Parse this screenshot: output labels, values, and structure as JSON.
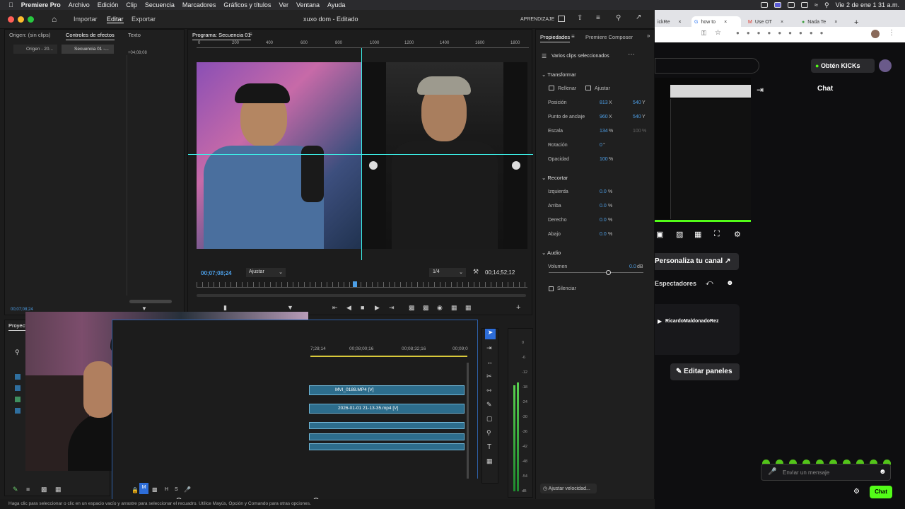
{
  "menubar": {
    "items": [
      "Premiere Pro",
      "Archivo",
      "Edición",
      "Clip",
      "Secuencia",
      "Marcadores",
      "Gráficos y títulos",
      "Ver",
      "Ventana",
      "Ayuda"
    ],
    "clock": "Vie 2 de ene  1 31 a.m."
  },
  "premiere": {
    "nav": {
      "import": "Importar",
      "edit": "Editar",
      "export": "Exportar"
    },
    "doc_title": "xuxo dom - Editado",
    "learning": "APRENDIZAJE",
    "source_panel": {
      "tabs": [
        "Origen: (sin clips)",
        "Controles de efectos",
        "Texto"
      ],
      "sub_tabs": [
        "Origen - 20...",
        "Secuencia 01 -..."
      ],
      "timecode_mini": "+04;08;08",
      "timecode": "00;07;08;24"
    },
    "program": {
      "title": "Programa: Secuencia 01",
      "ruler": [
        "0",
        "200",
        "400",
        "600",
        "800",
        "1000",
        "1200",
        "1400",
        "1600",
        "1800"
      ],
      "current_time": "00;07;08;24",
      "fit": "Ajustar",
      "quality": "1/4",
      "duration": "00;14;52;12"
    },
    "properties": {
      "tabs": [
        "Propiedades",
        "Premiere Composer"
      ],
      "selection": "Varios clips seleccionados",
      "transform": {
        "title": "Transformar",
        "fill": "Rellenar",
        "fit": "Ajustar",
        "rows": [
          {
            "label": "Posición",
            "v1": "813",
            "u1": "X",
            "v2": "540",
            "u2": "Y"
          },
          {
            "label": "Punto de anclaje",
            "v1": "960",
            "u1": "X",
            "v2": "540",
            "u2": "Y"
          },
          {
            "label": "Escala",
            "v1": "134",
            "u1": "%",
            "v2": "100",
            "u2": "%"
          },
          {
            "label": "Rotación",
            "v1": "0",
            "u1": "°",
            "v2": "",
            "u2": ""
          },
          {
            "label": "Opacidad",
            "v1": "100",
            "u1": "%",
            "v2": "",
            "u2": ""
          }
        ]
      },
      "crop": {
        "title": "Recortar",
        "rows": [
          {
            "label": "Izquierda",
            "value": "0.0",
            "unit": "%"
          },
          {
            "label": "Arriba",
            "value": "0.0",
            "unit": "%"
          },
          {
            "label": "Derecho",
            "value": "0.0",
            "unit": "%"
          },
          {
            "label": "Abajo",
            "value": "0.0",
            "unit": "%"
          }
        ]
      },
      "audio": {
        "title": "Audio",
        "volume_label": "Volumen",
        "volume_value": "0.0",
        "volume_unit": "dB",
        "mute": "Silenciar"
      },
      "speed": "Ajustar velocidad..."
    },
    "project": {
      "tab": "Proyecto"
    },
    "timeline": {
      "times": [
        "7;28;14",
        "00;08;00;16",
        "00;08;32;16",
        "00;09;0"
      ],
      "clip_v2": "MVI_0188.MP4 [V]",
      "clip_v1": "2026-01-01 21-13-35.mp4 [V]",
      "track_letters": [
        "M",
        "H",
        "S"
      ]
    },
    "meter_ticks": [
      "0",
      "-6",
      "-12",
      "-18",
      "-24",
      "-30",
      "-36",
      "-42",
      "-48",
      "-54",
      "dB"
    ],
    "status": "Haga clic para seleccionar o clic en un espacio vacío y arrastre para seleccionar el recuadro. Utilice Mayús, Opción y Comando para otras opciones."
  },
  "browser": {
    "tabs": [
      "ickRe",
      "how to",
      "Use OT",
      "Nada Te"
    ],
    "kick_button": "Obtén KICKs",
    "chat_title": "Chat",
    "customize": "Personaliza tu canal",
    "viewers": "Espectadores",
    "channel": "RicardoMaldonadoRez",
    "edit_panels": "Editar paneles",
    "message_placeholder": "Enviar un mensaje",
    "chat_button": "Chat"
  },
  "colors": {
    "accent": "#4d9fe7",
    "kick_green": "#53fc18",
    "program_guide": "#3cf0e8"
  }
}
